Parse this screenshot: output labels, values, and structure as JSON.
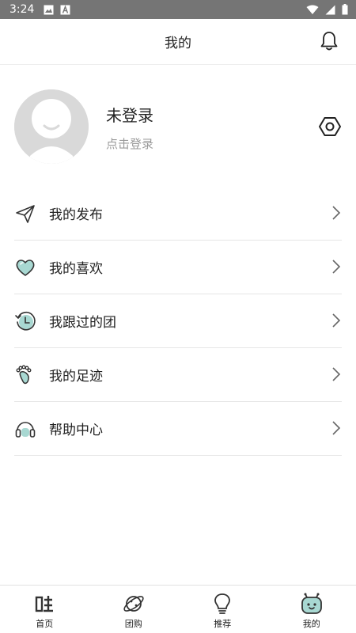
{
  "status_bar": {
    "time": "3:24",
    "icons": [
      "image-icon",
      "a-icon",
      "wifi-icon",
      "signal-icon",
      "battery-icon"
    ]
  },
  "header": {
    "title": "我的",
    "icon": "bell-icon"
  },
  "profile": {
    "name": "未登录",
    "hint": "点击登录",
    "settings_icon": "settings-hexagon-icon"
  },
  "menu": [
    {
      "label": "我的发布",
      "icon": "paper-plane-icon"
    },
    {
      "label": "我的喜欢",
      "icon": "heart-icon"
    },
    {
      "label": "我跟过的团",
      "icon": "history-clock-icon"
    },
    {
      "label": "我的足迹",
      "icon": "footprint-icon"
    },
    {
      "label": "帮助中心",
      "icon": "headset-icon"
    }
  ],
  "bottom_nav": [
    {
      "label": "首页",
      "icon": "home-wa-icon"
    },
    {
      "label": "团购",
      "icon": "planet-icon"
    },
    {
      "label": "推荐",
      "icon": "lightbulb-icon"
    },
    {
      "label": "我的",
      "icon": "robot-face-icon",
      "active": true
    }
  ],
  "colors": {
    "accent": "#a8d8d2",
    "status_bar": "#757575",
    "divider": "#e6e6e6",
    "hint_text": "#9a9a9a"
  }
}
